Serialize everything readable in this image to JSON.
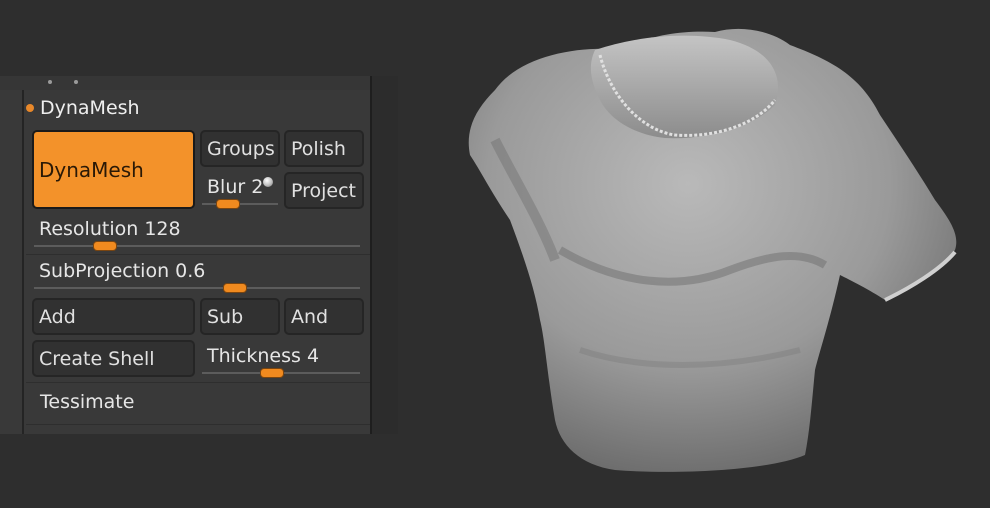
{
  "panel": {
    "section_title": "DynaMesh",
    "buttons": {
      "dynamesh": "DynaMesh",
      "groups": "Groups",
      "polish": "Polish",
      "project": "Project",
      "add": "Add",
      "sub": "Sub",
      "and": "And",
      "create_shell": "Create Shell"
    },
    "sliders": {
      "blur": {
        "label": "Blur 2",
        "value": 2,
        "fraction": 0.18
      },
      "resolution": {
        "label": "Resolution 128",
        "value": 128,
        "fraction": 0.18
      },
      "subprojection": {
        "label": "SubProjection 0.6",
        "value": 0.6,
        "fraction": 0.58
      },
      "thickness": {
        "label": "Thickness 4",
        "value": 4,
        "fraction": 0.37
      }
    },
    "tessimate": "Tessimate"
  },
  "colors": {
    "accent": "#f3922a",
    "panel_bg": "#393939",
    "background": "#2e2e2e"
  }
}
